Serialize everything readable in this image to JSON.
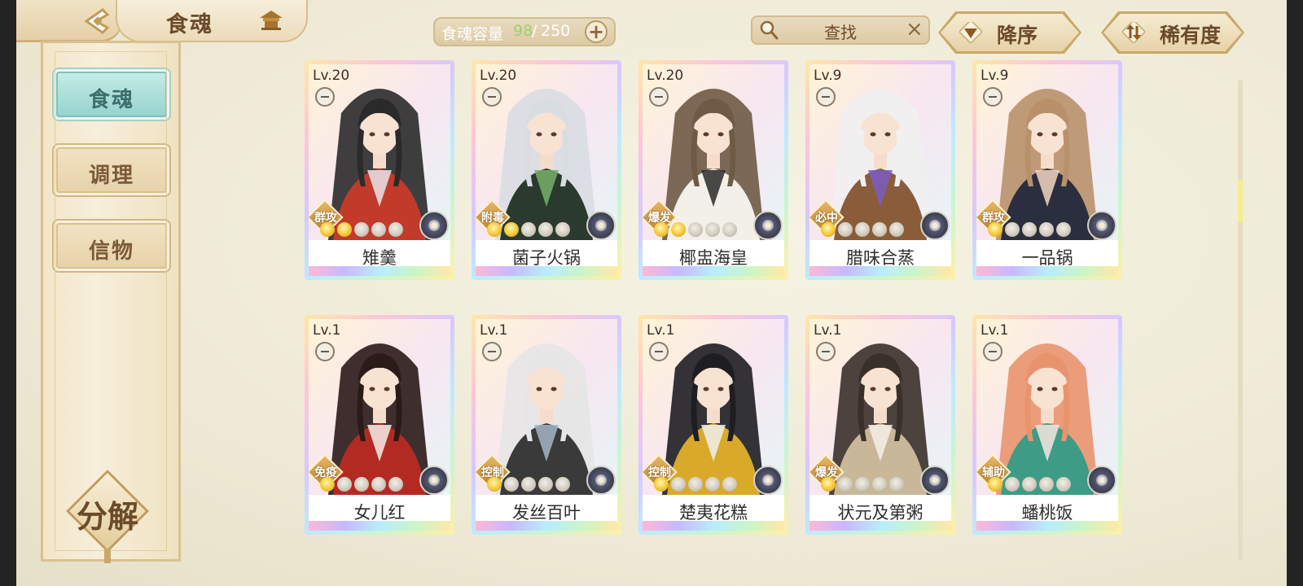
{
  "header": {
    "title": "食魂",
    "capacity_label": "食魂容量",
    "capacity_current": "98",
    "capacity_sep": "/",
    "capacity_max": "250",
    "capacity_plus": "+",
    "search_text": "查找",
    "search_clear": "×",
    "sort_label": "降序",
    "rarity_label": "稀有度"
  },
  "sidebar": {
    "items": [
      {
        "label": "食魂",
        "active": true
      },
      {
        "label": "调理",
        "active": false
      },
      {
        "label": "信物",
        "active": false
      }
    ],
    "decompose_label": "分解"
  },
  "colors": {
    "accent_teal": "#94d3cd",
    "gold": "#c9a868",
    "capacity_green": "#9bd16d"
  },
  "cards": [
    {
      "level": "Lv.20",
      "tag": "群攻",
      "name": "雉羹",
      "stars": 2,
      "palette": [
        "#2a2a2a",
        "#c23a2a",
        "#e9e4ea"
      ]
    },
    {
      "level": "Lv.20",
      "tag": "附毒",
      "name": "菌子火锅",
      "stars": 2,
      "palette": [
        "#d8dde2",
        "#2a3a2e",
        "#79b06a"
      ]
    },
    {
      "level": "Lv.20",
      "tag": "爆发",
      "name": "椰盅海皇",
      "stars": 2,
      "palette": [
        "#6e5a45",
        "#f2f0e8",
        "#2a2a2a"
      ]
    },
    {
      "level": "Lv.9",
      "tag": "必中",
      "name": "腊味合蒸",
      "stars": 1,
      "palette": [
        "#f0f0f0",
        "#8a5c3a",
        "#7a5cc2"
      ]
    },
    {
      "level": "Lv.9",
      "tag": "群攻",
      "name": "一品锅",
      "stars": 1,
      "palette": [
        "#b8916a",
        "#2b2e3e",
        "#f2d6c2"
      ]
    },
    {
      "level": "Lv.1",
      "tag": "免疫",
      "name": "女儿红",
      "stars": 1,
      "palette": [
        "#2a1a18",
        "#b32a22",
        "#f4efe8"
      ]
    },
    {
      "level": "Lv.1",
      "tag": "控制",
      "name": "发丝百叶",
      "stars": 1,
      "palette": [
        "#e6e6e6",
        "#3a3a3a",
        "#a5b6c6"
      ]
    },
    {
      "level": "Lv.1",
      "tag": "控制",
      "name": "楚夷花糕",
      "stars": 1,
      "palette": [
        "#1e1e22",
        "#d9a92a",
        "#eef0ee"
      ]
    },
    {
      "level": "Lv.1",
      "tag": "爆发",
      "name": "状元及第粥",
      "stars": 1,
      "palette": [
        "#3a302a",
        "#c9b79a",
        "#f4f0e8"
      ]
    },
    {
      "level": "Lv.1",
      "tag": "辅助",
      "name": "蟠桃饭",
      "stars": 1,
      "palette": [
        "#e9936e",
        "#3e9b86",
        "#f6e8e2"
      ]
    }
  ]
}
